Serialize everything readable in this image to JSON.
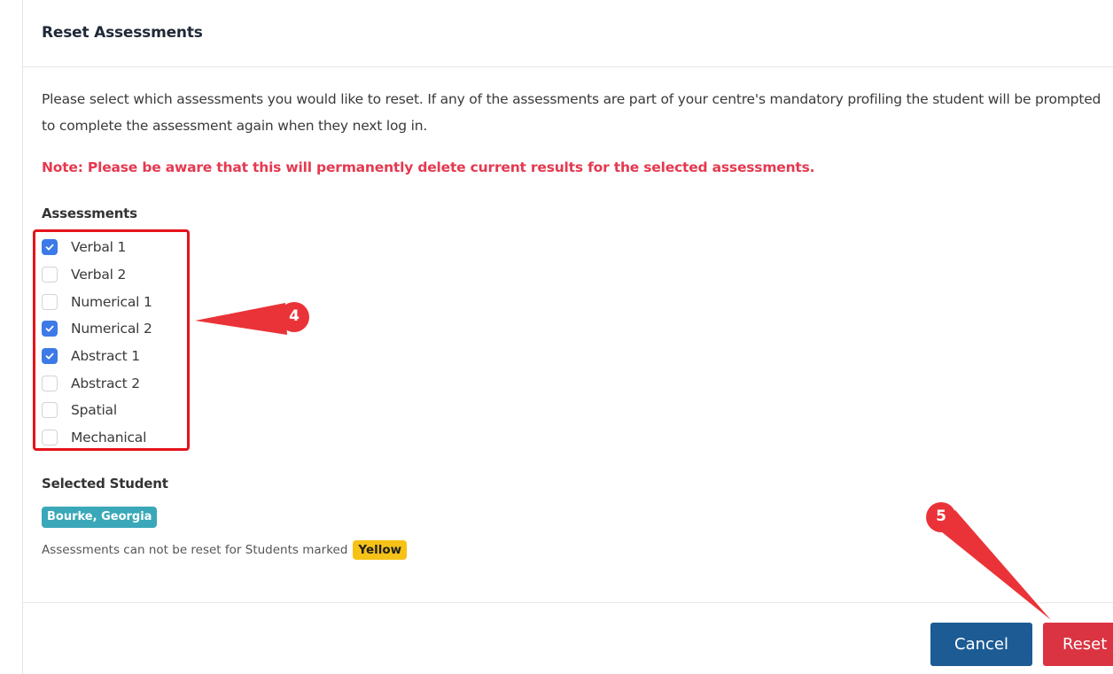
{
  "dialog": {
    "title": "Reset Assessments",
    "intro": "Please select which assessments you would like to reset. If any of the assessments are part of your centre's mandatory profiling the student will be prompted to complete the assessment again when they next log in.",
    "note": "Note: Please be aware that this will permanently delete current results for the selected assessments.",
    "assessments_label": "Assessments",
    "assessments": [
      {
        "label": "Verbal 1",
        "checked": true
      },
      {
        "label": "Verbal 2",
        "checked": false
      },
      {
        "label": "Numerical 1",
        "checked": false
      },
      {
        "label": "Numerical 2",
        "checked": true
      },
      {
        "label": "Abstract 1",
        "checked": true
      },
      {
        "label": "Abstract 2",
        "checked": false
      },
      {
        "label": "Spatial",
        "checked": false
      },
      {
        "label": "Mechanical",
        "checked": false
      }
    ],
    "selected_student_label": "Selected Student",
    "student_name": "Bourke, Georgia",
    "reset_info": "Assessments can not be reset for Students marked",
    "yellow_badge": "Yellow",
    "cancel_label": "Cancel",
    "reset_label": "Reset"
  },
  "annotations": {
    "callout_4": "4",
    "callout_5": "5"
  },
  "colors": {
    "checkbox_checked": "#3d7ae8",
    "note_red": "#e53950",
    "student_badge": "#3aa8b8",
    "yellow_badge": "#f6c218",
    "cancel_button": "#1c5b94",
    "reset_button": "#da3442",
    "annotation_red": "#e5131b"
  }
}
